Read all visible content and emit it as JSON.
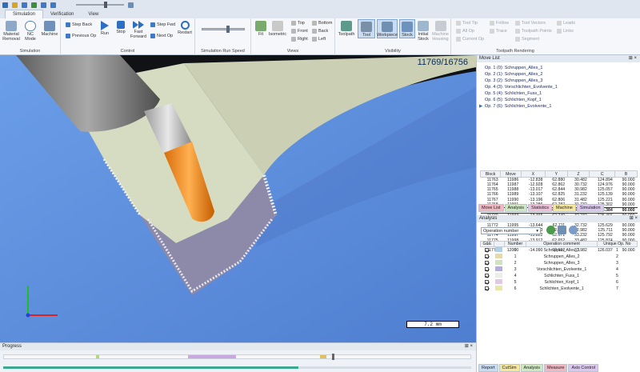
{
  "tabs": [
    "Simulation",
    "Verification",
    "View"
  ],
  "ribbon": {
    "simulation_group": {
      "label": "Simulation",
      "material_removal": "Material Removal",
      "nc_mode": "NC Mode",
      "machine": "Machine"
    },
    "control_group": {
      "label": "Control",
      "step_back": "Step Back",
      "previous_op": "Previous Op",
      "run": "Run",
      "stop": "Stop",
      "fast_forward": "Fast Forward",
      "step_fwd": "Step Fwd",
      "next_op": "Next Op",
      "restart": "Restart"
    },
    "speed_group": {
      "label": "Simulation Run Speed",
      "speed_value": 0.6
    },
    "views_group": {
      "label": "Views",
      "fit": "Fit",
      "isometric": "Isometric",
      "top": "Top",
      "front": "Front",
      "right": "Right",
      "bottom": "Bottom",
      "back": "Back",
      "left": "Left"
    },
    "visibility_group": {
      "label": "Visibility",
      "toolpath": "Toolpath",
      "tool": "Tool",
      "workpiece": "Workpiece",
      "stock": "Stock",
      "initial_stock": "Initial Stock",
      "machine_housing": "Machine Housing"
    },
    "toolpath_group": {
      "label": "Toolpath Rendering",
      "tool_tip": "Tool Tip",
      "all_op": "All Op",
      "current_op": "Current Op",
      "follow": "Follow",
      "trace": "Trace",
      "tool_vectors": "Tool Vectors",
      "toolpath_points": "Toolpath Points",
      "segment": "Segment",
      "leads": "Leads",
      "links": "Links"
    }
  },
  "viewport": {
    "counter": "11769/16756",
    "scale": "7.2 mm"
  },
  "progress": {
    "title": "Progress",
    "pin": "⊞ ×",
    "fraction": 0.63
  },
  "move_list": {
    "title": "Move List",
    "operations": [
      "Op. 1 (0): Schruppen_Alles_1",
      "Op. 2 (1): Schruppen_Alles_2",
      "Op. 3 (2): Schruppen_Alles_3",
      "Op. 4 (3): Vorschlichten_Evolvente_1",
      "Op. 5 (4): Schlichten_Fuss_1",
      "Op. 6 (5): Schlichten_Kopf_1",
      "Op. 7 (6): Schlichten_Evolvente_1"
    ],
    "columns": [
      "Block",
      "Move",
      "X",
      "Y",
      "Z",
      "C",
      "B"
    ],
    "rows": [
      [
        "11763",
        "11986",
        "-12.838",
        "62.880",
        "30.482",
        "124.894",
        "90.000"
      ],
      [
        "11764",
        "11987",
        "-12.928",
        "62.862",
        "30.732",
        "124.976",
        "90.000"
      ],
      [
        "11765",
        "11988",
        "-13.017",
        "62.844",
        "30.982",
        "125.057",
        "90.000"
      ],
      [
        "11766",
        "11989",
        "-13.107",
        "62.825",
        "31.232",
        "125.139",
        "90.000"
      ],
      [
        "11767",
        "11990",
        "-13.196",
        "62.806",
        "31.482",
        "125.221",
        "90.000"
      ],
      [
        "11768",
        "11991",
        "-13.286",
        "62.787",
        "31.732",
        "125.302",
        "90.000"
      ],
      [
        "11769",
        "11992",
        "-13.375",
        "62.768",
        "31.982",
        "125.384",
        "90.000"
      ],
      [
        "11770",
        "11993",
        "-13.465",
        "62.749",
        "32.232",
        "125.466",
        "90.000"
      ],
      [
        "11771",
        "11994",
        "-13.554",
        "62.730",
        "32.482",
        "125.547",
        "90.000"
      ],
      [
        "11772",
        "11995",
        "-13.644",
        "62.711",
        "32.732",
        "125.629",
        "90.000"
      ],
      [
        "11773",
        "11996",
        "-13.733",
        "62.691",
        "32.982",
        "125.711",
        "90.000"
      ],
      [
        "11774",
        "11997",
        "-13.822",
        "62.671",
        "33.232",
        "125.792",
        "90.000"
      ],
      [
        "11775",
        "11998",
        "-13.912",
        "62.652",
        "33.482",
        "125.874",
        "90.000"
      ],
      [
        "11776",
        "11999",
        "-14.001",
        "62.632",
        "33.732",
        "125.956",
        "90.000"
      ],
      [
        "11777",
        "12000",
        "-14.090",
        "62.612",
        "33.982",
        "126.037",
        "90.000"
      ]
    ],
    "current_index": 6,
    "bottom_tabs": [
      "Move List",
      "Analysis",
      "Statistics",
      "Machine",
      "Simulation"
    ]
  },
  "analysis": {
    "title": "Analysis",
    "select_value": "Operation number",
    "columns": [
      "G&E",
      "",
      "Number",
      "Operation comment",
      "Unique Op. No"
    ],
    "rows": [
      {
        "number": "0",
        "comment": "Schruppen_Alles_1",
        "unique": "1",
        "color": "#b0cfe8"
      },
      {
        "number": "1",
        "comment": "Schruppen_Alles_2",
        "unique": "2",
        "color": "#e8d9a8"
      },
      {
        "number": "2",
        "comment": "Schruppen_Alles_3",
        "unique": "3",
        "color": "#cfe3c0"
      },
      {
        "number": "3",
        "comment": "Vorschlichten_Evolvente_1",
        "unique": "4",
        "color": "#b2aede"
      },
      {
        "number": "4",
        "comment": "Schlichten_Fuss_1",
        "unique": "5",
        "color": "#ececec"
      },
      {
        "number": "5",
        "comment": "Schlichten_Kopf_1",
        "unique": "6",
        "color": "#e2c8e8"
      },
      {
        "number": "6",
        "comment": "Schlichten_Evolvente_1",
        "unique": "7",
        "color": "#eae6a6"
      }
    ],
    "bottom_tabs": [
      "Report",
      "CutSim",
      "Analysis",
      "Measure",
      "Axis Control"
    ]
  }
}
